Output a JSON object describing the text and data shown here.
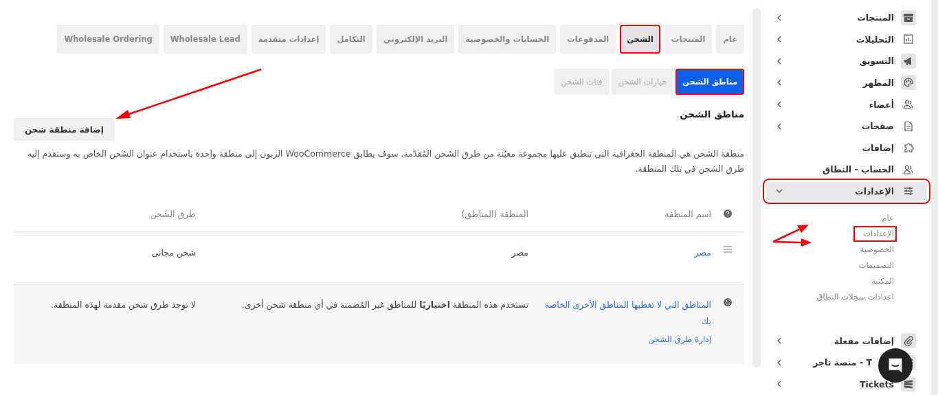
{
  "tabs": [
    {
      "label": "عام",
      "selected": false,
      "highlighted": false
    },
    {
      "label": "المنتجات",
      "selected": false,
      "highlighted": false
    },
    {
      "label": "الشحن",
      "selected": true,
      "highlighted": true
    },
    {
      "label": "المدفوعات",
      "selected": false,
      "highlighted": false
    },
    {
      "label": "الحسابات والخصوصية",
      "selected": false,
      "highlighted": false
    },
    {
      "label": "البريد الإلكتروني",
      "selected": false,
      "highlighted": false
    },
    {
      "label": "التكامل",
      "selected": false,
      "highlighted": false
    },
    {
      "label": "إعدادات متقدمة",
      "selected": false,
      "highlighted": false
    },
    {
      "label": "Wholesale Lead",
      "selected": false,
      "highlighted": false
    },
    {
      "label": "Wholesale Ordering",
      "selected": false,
      "highlighted": false
    }
  ],
  "subtabs": [
    {
      "label": "مناطق الشحن",
      "selected": true,
      "highlighted": true
    },
    {
      "label": "خيارات الشحن",
      "selected": false,
      "highlighted": false
    },
    {
      "label": "فئات الشحن",
      "selected": false,
      "highlighted": false
    }
  ],
  "section": {
    "title": "مناطق الشحن",
    "add_button": "إضافة منطقة شحن",
    "description": "منطقة الشحن هي المنطقة الجغرافية التي تنطبق عليها مجموعة معيّنة من طرق الشحن المُقدّمة. سوف يطابق WooCommerce الزبون إلى منطقة واحدة باستخدام عنوان الشحن الخاص به وستقدم إليه طرق الشحن في تلك المنطقة."
  },
  "table": {
    "columns": [
      "اسم المنطقة",
      "المنطقة (المناطق)",
      "طرق الشحن"
    ],
    "rows": [
      {
        "name": "مصر",
        "regions": "مصر",
        "methods": "شحن مجانى"
      }
    ],
    "rest_of_world": {
      "name": "المناطق التي لا تغطيها المناطق الأخرى الخاصة بك",
      "link": "إدارة طرق الشحن",
      "description": "تستخدم هذه المنطقة **اختياريًا** للمناطق غير المُضمنة في أي منطقة شحن أخرى.",
      "methods": "لا توجد طرق شحن مقدمة لهذه المنطقة."
    }
  },
  "sidebar": {
    "items": [
      {
        "label": "المنتجات",
        "kind": "group",
        "expanded": false,
        "highlighted": false
      },
      {
        "label": "التحليلات",
        "kind": "group",
        "expanded": false,
        "highlighted": false
      },
      {
        "label": "التسويق",
        "kind": "group",
        "expanded": false,
        "highlighted": false
      },
      {
        "label": "المظهر",
        "kind": "group",
        "expanded": false,
        "highlighted": false
      },
      {
        "label": "أعضاء",
        "kind": "group",
        "expanded": false,
        "highlighted": false
      },
      {
        "label": "صفحات",
        "kind": "group",
        "expanded": false,
        "highlighted": false
      },
      {
        "label": "إضافات",
        "kind": "link",
        "highlighted": false
      },
      {
        "label": "الحساب - النطاق",
        "kind": "link",
        "highlighted": false
      },
      {
        "label": "الإعدادات",
        "kind": "group",
        "expanded": true,
        "highlighted": true,
        "children": [
          {
            "label": "عام",
            "highlighted": false
          },
          {
            "label": "الإعدادات",
            "highlighted": true
          },
          {
            "label": "الخصوصية",
            "highlighted": false
          },
          {
            "label": "التصميمات",
            "highlighted": false
          },
          {
            "label": "المكتبة",
            "highlighted": false
          },
          {
            "label": "اعدادات سجلات النطاق",
            "highlighted": false
          }
        ]
      },
      {
        "label": "إضافات مفعلة",
        "kind": "group",
        "expanded": false,
        "highlighted": false
      },
      {
        "label": "T - منصة تاجر",
        "kind": "group",
        "expanded": false,
        "highlighted": false
      },
      {
        "label": "Tickets",
        "kind": "group",
        "expanded": false,
        "highlighted": false
      }
    ]
  }
}
